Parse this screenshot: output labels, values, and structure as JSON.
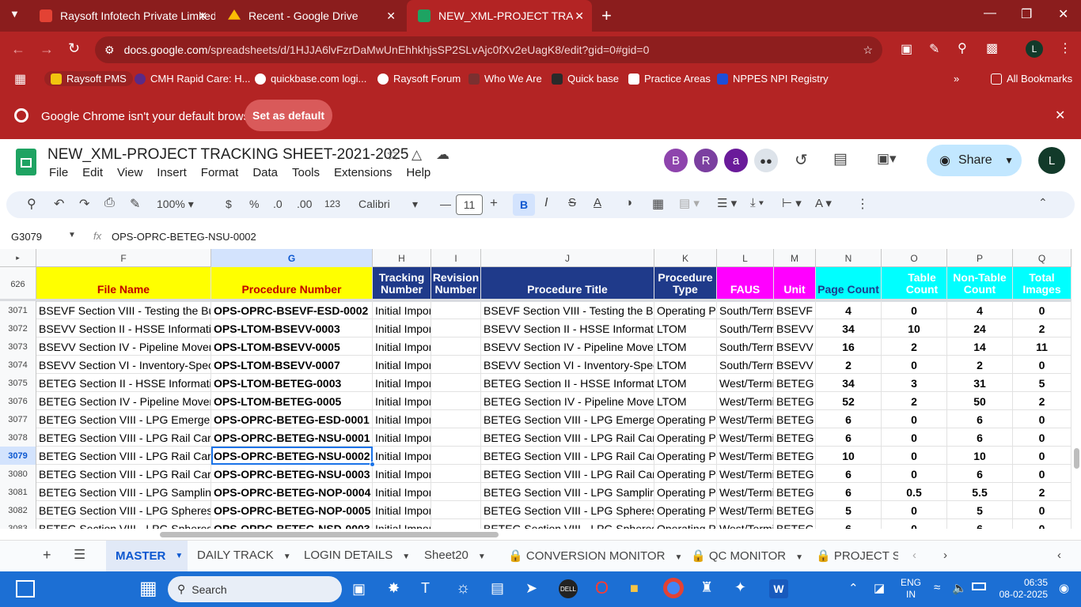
{
  "browser": {
    "tabs": [
      {
        "title": "Raysoft Infotech Private Limited",
        "color": "#e34234"
      },
      {
        "title": "Recent - Google Drive",
        "color": "#fbbc04"
      },
      {
        "title": "NEW_XML-PROJECT TRACKING",
        "color": "#1ea362"
      }
    ],
    "url_host": "docs.google.com",
    "url_path": "/spreadsheets/d/1HJJA6lvFzrDaMwUnEhhkhjsSP2SLvAjc0fXv2eUagK8/edit?gid=0#gid=0",
    "profile_initial": "L",
    "bookmarks": [
      "Raysoft PMS",
      "CMH Rapid Care: H...",
      "quickbase.com logi...",
      "Raysoft Forum",
      "Who We Are",
      "Quick base",
      "Practice Areas",
      "NPPES NPI Registry"
    ],
    "all_bookmarks": "All Bookmarks",
    "infobar_text": "Google Chrome isn't your default browser",
    "set_default": "Set as default"
  },
  "doc": {
    "title": "NEW_XML-PROJECT TRACKING SHEET-2021-2025",
    "menu": [
      "File",
      "Edit",
      "View",
      "Insert",
      "Format",
      "Data",
      "Tools",
      "Extensions",
      "Help"
    ],
    "collaborators": [
      {
        "initial": "B",
        "color": "#8e44ad"
      },
      {
        "initial": "R",
        "color": "#7b3fa0"
      },
      {
        "initial": "a",
        "color": "#6a1b9a"
      }
    ],
    "share": "Share",
    "user_initial": "L",
    "toolbar": {
      "zoom": "100%",
      "currency": "$",
      "percent": "%",
      "dec_less": ".0",
      "dec_more": ".00",
      "format123": "123",
      "font": "Calibri",
      "font_size": "11"
    },
    "name_box": "G3079",
    "formula": "OPS-OPRC-BETEG-NSU-0002",
    "frozen_label": "626"
  },
  "grid": {
    "columns": [
      "F",
      "G",
      "H",
      "I",
      "J",
      "K",
      "L",
      "M",
      "N",
      "O",
      "P",
      "Q"
    ],
    "headers": [
      "File Name",
      "Procedure Number",
      "Tracking Number",
      "Revision Number",
      "Procedure Title",
      "Procedure Type",
      "FAUS",
      "Unit",
      "Page Count",
      "Table Count",
      "Non-Table Count",
      "Total Images"
    ],
    "header_colors": {
      "yellow": "#ffff00",
      "navy": "#1f3a8a",
      "magenta": "#ff00ff",
      "cyan": "#00ffff"
    },
    "rows": [
      {
        "n": "3071",
        "f": "BSEVF Section VIII - Testing the Butan",
        "g": "OPS-OPRC-BSEVF-ESD-0002",
        "h": "Initial Import",
        "i": "",
        "j": "BSEVF Section VIII - Testing the Butan",
        "k": "Operating Pr",
        "l": "South/Term",
        "m": "BSEVF",
        "np": "4",
        "o": "0",
        "p": "4",
        "q": "0"
      },
      {
        "n": "3072",
        "f": "BSEVV Section II - HSSE Information",
        "g": "OPS-LTOM-BSEVV-0003",
        "h": "Initial Import",
        "i": "",
        "j": "BSEVV Section II - HSSE Information",
        "k": "LTOM",
        "l": "South/Term",
        "m": "BSEVV",
        "np": "34",
        "o": "10",
        "p": "24",
        "q": "2"
      },
      {
        "n": "3073",
        "f": "BSEVV Section IV - Pipeline Moveme",
        "g": "OPS-LTOM-BSEVV-0005",
        "h": "Initial Import",
        "i": "",
        "j": "BSEVV Section IV - Pipeline Moveme",
        "k": "LTOM",
        "l": "South/Term",
        "m": "BSEVV",
        "np": "16",
        "o": "2",
        "p": "14",
        "q": "11"
      },
      {
        "n": "3074",
        "f": "BSEVV Section VI - Inventory-Specific",
        "g": "OPS-LTOM-BSEVV-0007",
        "h": "Initial Import",
        "i": "",
        "j": "BSEVV Section VI - Inventory-Specific",
        "k": "LTOM",
        "l": "South/Term",
        "m": "BSEVV",
        "np": "2",
        "o": "0",
        "p": "2",
        "q": "0"
      },
      {
        "n": "3075",
        "f": "BETEG Section II - HSSE Information",
        "g": "OPS-LTOM-BETEG-0003",
        "h": "Initial Import",
        "i": "",
        "j": "BETEG Section II - HSSE Information",
        "k": "LTOM",
        "l": "West/Termi",
        "m": "BETEG",
        "np": "34",
        "o": "3",
        "p": "31",
        "q": "5"
      },
      {
        "n": "3076",
        "f": "BETEG Section IV - Pipeline Moveme",
        "g": "OPS-LTOM-BETEG-0005",
        "h": "Initial Import",
        "i": "",
        "j": "BETEG Section IV - Pipeline Moveme",
        "k": "LTOM",
        "l": "West/Termi",
        "m": "BETEG",
        "np": "52",
        "o": "2",
        "p": "50",
        "q": "2"
      },
      {
        "n": "3077",
        "f": "BETEG Section VIII - LPG Emergency S",
        "g": "OPS-OPRC-BETEG-ESD-0001",
        "h": "Initial Import",
        "i": "",
        "j": "BETEG Section VIII - LPG Emergency",
        "k": "Operating Pr",
        "l": "West/Termi",
        "m": "BETEG",
        "np": "6",
        "o": "0",
        "p": "6",
        "q": "0"
      },
      {
        "n": "3078",
        "f": "BETEG Section VIII - LPG Rail Car Loa",
        "g": "OPS-OPRC-BETEG-NSU-0001",
        "h": "Initial Import",
        "i": "",
        "j": "BETEG Section VIII - LPG Rail Car Loa",
        "k": "Operating Pr",
        "l": "West/Termi",
        "m": "BETEG",
        "np": "6",
        "o": "0",
        "p": "6",
        "q": "0"
      },
      {
        "n": "3079",
        "f": "BETEG Section VIII - LPG Rail Car Loa",
        "g": "OPS-OPRC-BETEG-NSU-0002",
        "h": "Initial Import",
        "i": "",
        "j": "BETEG Section VIII - LPG Rail Car Loa",
        "k": "Operating Pr",
        "l": "West/Termi",
        "m": "BETEG",
        "np": "10",
        "o": "0",
        "p": "10",
        "q": "0"
      },
      {
        "n": "3080",
        "f": "BETEG Section VIII - LPG Rail Car Unl",
        "g": "OPS-OPRC-BETEG-NSU-0003",
        "h": "Initial Import",
        "i": "",
        "j": "BETEG Section VIII - LPG Rail Car Unl",
        "k": "Operating Pr",
        "l": "West/Termi",
        "m": "BETEG",
        "np": "6",
        "o": "0",
        "p": "6",
        "q": "0"
      },
      {
        "n": "3081",
        "f": "BETEG Section VIII - LPG Sampling Pr",
        "g": "OPS-OPRC-BETEG-NOP-0004",
        "h": "Initial Import",
        "i": "",
        "j": "BETEG Section VIII - LPG Sampling Pr",
        "k": "Operating Pr",
        "l": "West/Termi",
        "m": "BETEG",
        "np": "6",
        "o": "0.5",
        "p": "5.5",
        "q": "2"
      },
      {
        "n": "3082",
        "f": "BETEG Section VIII - LPG Spheres Inc",
        "g": "OPS-OPRC-BETEG-NOP-0005",
        "h": "Initial Import",
        "i": "",
        "j": "BETEG Section VIII - LPG Spheres Inc",
        "k": "Operating Pr",
        "l": "West/Termi",
        "m": "BETEG",
        "np": "5",
        "o": "0",
        "p": "5",
        "q": "0"
      },
      {
        "n": "3083",
        "f": "BETEG Section VIII - LPG Spheres Nor",
        "g": "OPS-OPRC-BETEG-NSD-0003",
        "h": "Initial Import",
        "i": "",
        "j": "BETEG Section VIII - LPG Spheres No",
        "k": "Operating Pr",
        "l": "West/Termi",
        "m": "BETEG",
        "np": "6",
        "o": "0",
        "p": "6",
        "q": "0"
      }
    ],
    "selected_row": "3079"
  },
  "sheets": [
    "MASTER",
    "DAILY TRACK",
    "LOGIN DETAILS",
    "Sheet20",
    "CONVERSION MONITOR",
    "QC MONITOR",
    "PROJECT SU"
  ],
  "taskbar": {
    "search": "Search",
    "lang1": "ENG",
    "lang2": "IN",
    "time": "06:35",
    "date": "08-02-2025"
  }
}
